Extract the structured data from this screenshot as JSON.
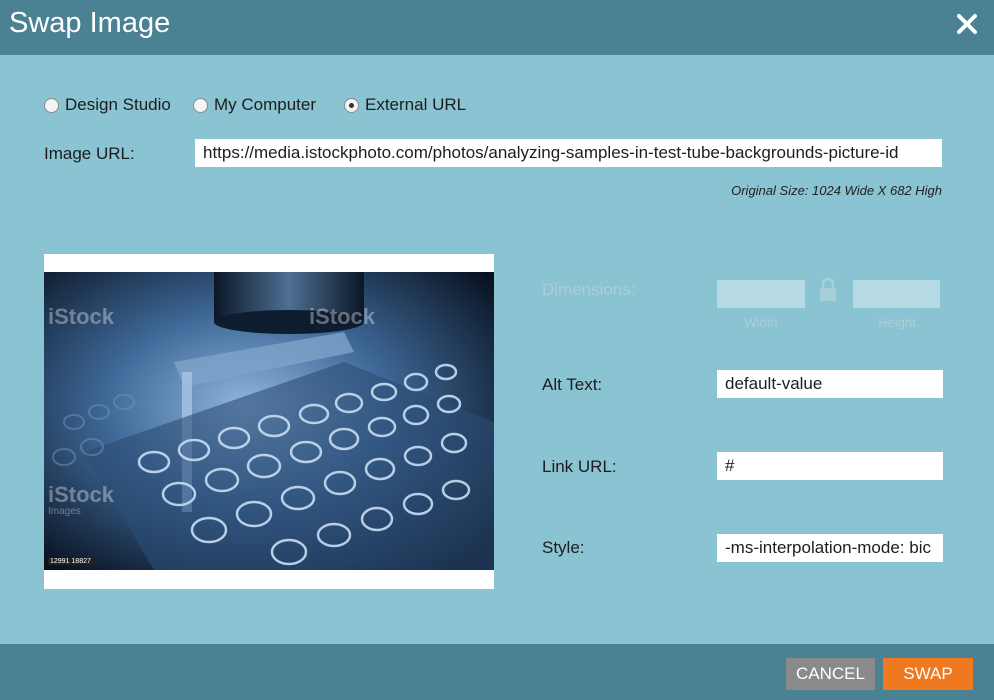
{
  "dialog": {
    "title": "Swap Image"
  },
  "source": {
    "options": [
      "Design Studio",
      "My Computer",
      "External URL"
    ],
    "selected": "External URL"
  },
  "image_url": {
    "label": "Image URL:",
    "value": "https://media.istockphoto.com/photos/analyzing-samples-in-test-tube-backgrounds-picture-id"
  },
  "original_size": "Original Size: 1024 Wide X 682 High",
  "dimensions": {
    "label": "Dimensions:",
    "width_label": "Width",
    "height_label": "Height",
    "width_value": "",
    "height_value": ""
  },
  "alt_text": {
    "label": "Alt Text:",
    "value": "default-value"
  },
  "link_url": {
    "label": "Link URL:",
    "value": "#"
  },
  "style": {
    "label": "Style:",
    "value": "-ms-interpolation-mode: bic"
  },
  "preview": {
    "watermark": "iStock",
    "watermark_sub": "Images",
    "id_tag": "12991 18827"
  },
  "footer": {
    "cancel_label": "CANCEL",
    "swap_label": "SWAP"
  },
  "colors": {
    "titlebar": "#4a8193",
    "body": "#8ac3d2",
    "swap_button": "#f0781e",
    "cancel_button": "#8a8a8a"
  }
}
